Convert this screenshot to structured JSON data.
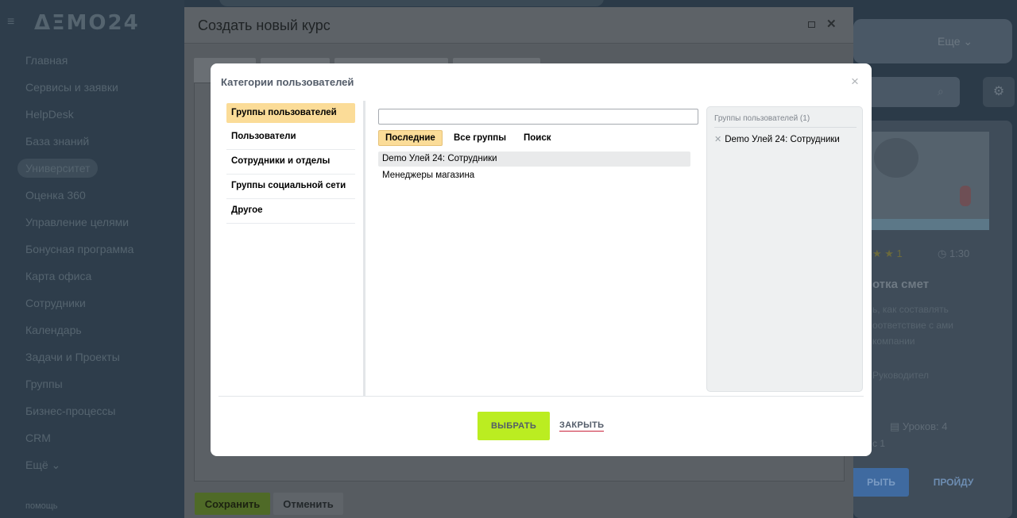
{
  "portal": {
    "logo": "ΔΞMO24",
    "nav_items": [
      "Главная",
      "Сервисы и заявки",
      "HelpDesk",
      "База знаний",
      "Университет",
      "Оценка 360",
      "Управление целями",
      "Бонусная программа",
      "Карта офиса",
      "Сотрудники",
      "Календарь",
      "Задачи и Проекты",
      "Группы",
      "Бизнес-процессы",
      "CRM",
      "Ещё ⌄"
    ],
    "help_label": "помощь",
    "more_label": "Еще ⌄",
    "card": {
      "rating": "★ ★ 1",
      "time": "1:30",
      "title": "отка смет",
      "description": "ь, как составлять оответствие с ами компании",
      "author": "Руководител",
      "lessons": "Уроков: 4",
      "lessons2": "с 1",
      "open_label": "РЫТЬ",
      "pass_label": "ПРОЙДУ"
    }
  },
  "course_dialog": {
    "title": "Создать новый курс",
    "save_label": "Сохранить",
    "cancel_label": "Отменить"
  },
  "popup": {
    "title": "Категории пользователей",
    "categories": [
      "Группы пользователей",
      "Пользователи",
      "Сотрудники и отделы",
      "Группы социальной сети",
      "Другое"
    ],
    "search_value": "",
    "tabs": [
      "Последние",
      "Все группы",
      "Поиск"
    ],
    "results": [
      "Demo Улей 24: Сотрудники",
      "Менеджеры магазина"
    ],
    "selected_header": "Группы пользователей (1)",
    "selected_items": [
      "Demo Улей 24: Сотрудники"
    ],
    "select_label": "ВЫБРАТЬ",
    "close_label": "ЗАКРЫТЬ"
  },
  "colors": {
    "highlight": "#fbdc98",
    "primary_button": "#bbed21",
    "close_underline": "#c9233b"
  }
}
